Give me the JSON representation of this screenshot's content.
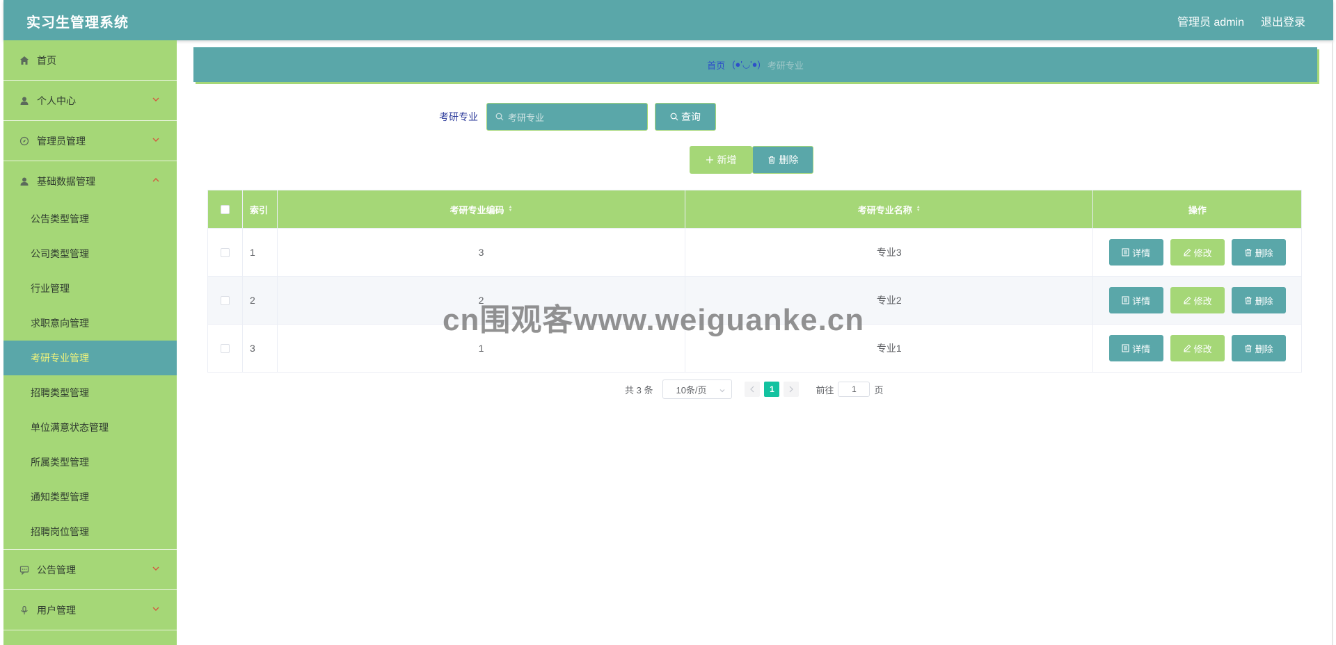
{
  "app": {
    "title": "实习生管理系统"
  },
  "header": {
    "user_label": "管理员 admin",
    "logout_label": "退出登录"
  },
  "sidebar": {
    "home": "首页",
    "personal": "个人中心",
    "admin_mgmt": "管理员管理",
    "basic_data": "基础数据管理",
    "sub_items": [
      "公告类型管理",
      "公司类型管理",
      "行业管理",
      "求职意向管理",
      "考研专业管理",
      "招聘类型管理",
      "单位满意状态管理",
      "所属类型管理",
      "通知类型管理",
      "招聘岗位管理"
    ],
    "active_sub": "考研专业管理",
    "notice_mgmt": "公告管理",
    "user_mgmt": "用户管理"
  },
  "breadcrumb": {
    "home": "首页",
    "separator": "(●'◡'●)",
    "current": "考研专业"
  },
  "search": {
    "label": "考研专业",
    "placeholder": "考研专业",
    "button": "查询"
  },
  "actions": {
    "add": "新增",
    "delete": "删除"
  },
  "table": {
    "headers": {
      "index": "索引",
      "code": "考研专业编码",
      "name": "考研专业名称",
      "ops": "操作"
    },
    "rows": [
      {
        "index": "1",
        "code": "3",
        "name": "专业3"
      },
      {
        "index": "2",
        "code": "2",
        "name": "专业2"
      },
      {
        "index": "3",
        "code": "1",
        "name": "专业1"
      }
    ],
    "op_labels": {
      "detail": "详情",
      "edit": "修改",
      "delete": "删除"
    }
  },
  "pagination": {
    "total": "共 3 条",
    "page_size": "10条/页",
    "current_page": "1",
    "goto_label": "前往",
    "goto_value": "1",
    "page_suffix": "页"
  },
  "watermark": "cn围观客www.weiguanke.cn",
  "colors": {
    "teal": "#5aa7a9",
    "green": "#a5d777",
    "active_text": "#f3f57a",
    "page_active": "#13c2a0"
  }
}
